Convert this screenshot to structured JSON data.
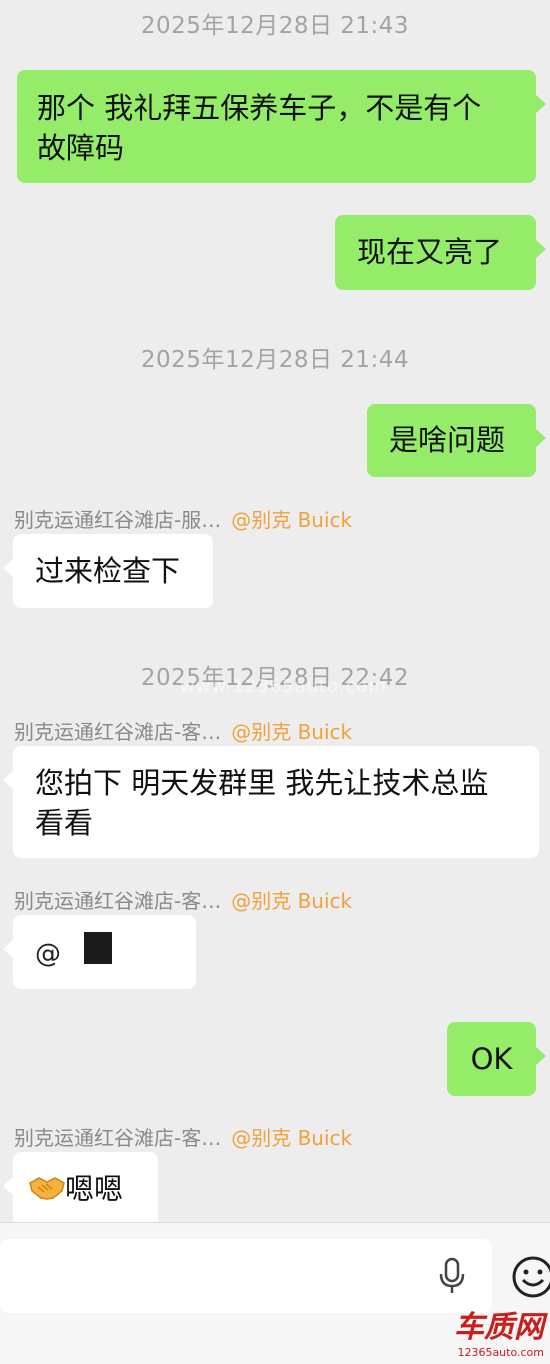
{
  "messages": {
    "ts1": "2025年12月28日 21:43",
    "m1_line1": "那个 我礼拜五保养车子，不是有个",
    "m1_line2": "故障码",
    "m2": "现在又亮了",
    "ts2": "2025年12月28日 21:44",
    "m3": "是啥问题",
    "s1_name": "别克运通红谷滩店-服…",
    "s1_mention": "@别克 Buick",
    "m4": "过来检查下",
    "ts3": "2025年12月28日 22:42",
    "s2_name": "别克运通红谷滩店-客…",
    "s2_mention": "@别克 Buick",
    "m5_line1": "您拍下 明天发群里 我先让技术总监",
    "m5_line2": "看看",
    "s3_name": "别克运通红谷滩店-客…",
    "s3_mention": "@别克 Buick",
    "m6_at": "@",
    "m7": "OK",
    "s4_name": "别克运通红谷滩店-客…",
    "s4_mention": "@别克 Buick",
    "m8": "嗯嗯"
  },
  "watermark": "www.12365auto.com",
  "logo": {
    "name": "车质网",
    "url": "12365auto.com"
  }
}
